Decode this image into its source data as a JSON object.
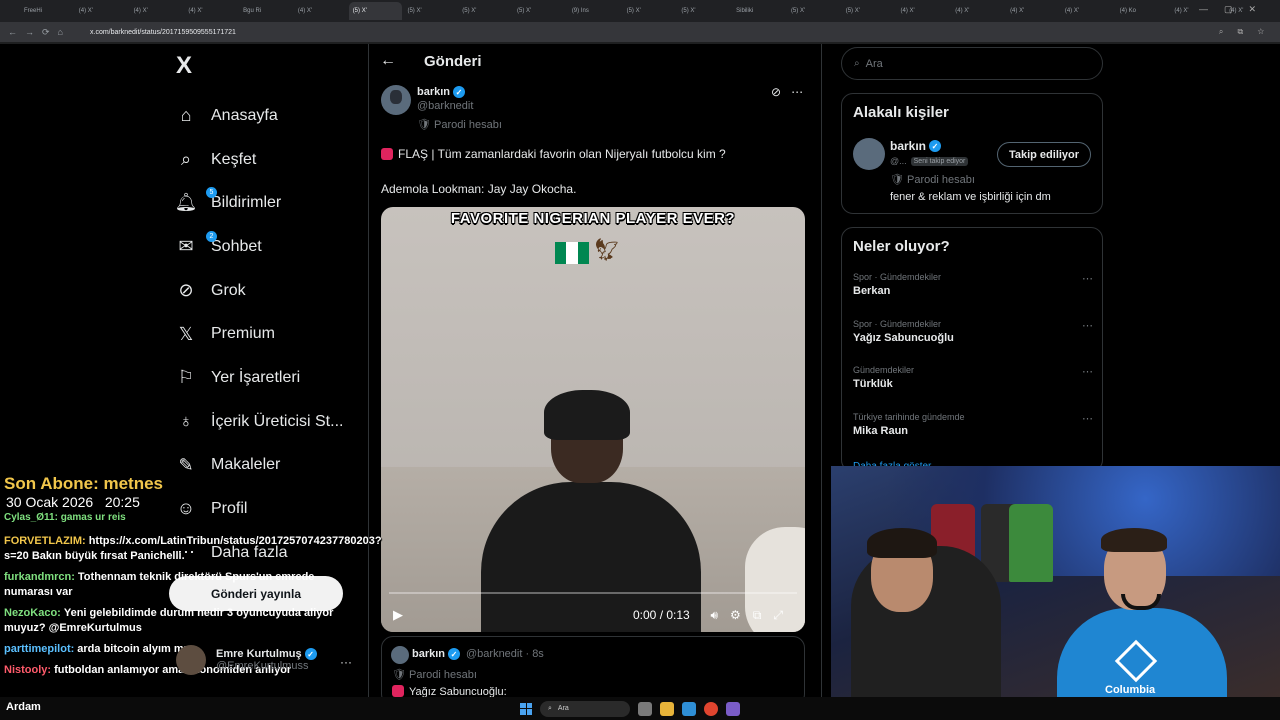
{
  "browser": {
    "tabs": [
      "FreeHi",
      "(4) X'",
      "(4) X'",
      "(4) X'",
      "Bgu Ri",
      "(4) X'",
      "(5) X'",
      "(5) X'",
      "(5) X'",
      "(5) X'",
      "(9) Ins",
      "(5) X'",
      "(5) X'",
      "Sibiliki",
      "(5) X'",
      "(5) X'",
      "(4) X'",
      "(4) X'",
      "(4) X'",
      "(4) X'",
      "(4) Ko",
      "(4) X'",
      "(4) X'"
    ],
    "url": "x.com/barknedit/status/2017159509555171721",
    "address_icons": "⌕ ⧉ ☆",
    "nav_icons": "←→⟳⌂"
  },
  "sidebar": {
    "logo": "X",
    "items": [
      {
        "label": "Anasayfa",
        "icon": "home-icon",
        "glyph": "⌂"
      },
      {
        "label": "Keşfet",
        "icon": "search-icon",
        "glyph": "⌕"
      },
      {
        "label": "Bildirimler",
        "icon": "bell-icon",
        "glyph": "🔔︎",
        "badge": "5"
      },
      {
        "label": "Sohbet",
        "icon": "mail-icon",
        "glyph": "✉",
        "badge": "2"
      },
      {
        "label": "Grok",
        "icon": "grok-icon",
        "glyph": "⊘"
      },
      {
        "label": "Premium",
        "icon": "x-premium-icon",
        "glyph": "𝕏"
      },
      {
        "label": "Yer İşaretleri",
        "icon": "bookmark-icon",
        "glyph": "⚐"
      },
      {
        "label": "İçerik Üreticisi St...",
        "icon": "creator-studio-icon",
        "glyph": "♁"
      },
      {
        "label": "Makaleler",
        "icon": "articles-icon",
        "glyph": "✎"
      },
      {
        "label": "Profil",
        "icon": "profile-icon",
        "glyph": "☺"
      },
      {
        "label": "Daha fazla",
        "icon": "more-icon",
        "glyph": "⋯"
      }
    ],
    "post_button": "Gönderi yayınla",
    "account": {
      "name": "Emre Kurtulmuş",
      "handle": "@EmreKurtulmuss",
      "more": "···"
    }
  },
  "main": {
    "title": "Gönderi",
    "back": "←",
    "post": {
      "author": "barkın",
      "handle": "@barknedit",
      "parody": "Parodi hesabı",
      "text1": "FLAŞ | Tüm zamanlardaki favorin olan Nijeryalı futbolcu kim ?",
      "text2": "Ademola Lookman: Jay Jay Okocha.",
      "video": {
        "overlay_title": "FAVORITE NIGERIAN PLAYER EVER?",
        "time": "0:00 / 0:13",
        "progress": 0.0
      }
    },
    "reply": {
      "author": "barkın",
      "handle": "@barknedit · 8s",
      "parody": "Parodi hesabı",
      "text": "Yağız Sabuncuoğlu:"
    }
  },
  "right": {
    "search_placeholder": "Ara",
    "related": {
      "title": "Alakalı kişiler",
      "name": "barkın",
      "handle": "@...",
      "follows_you": "Seni takip ediyor",
      "follow_button": "Takip ediliyor",
      "parody": "Parodi hesabı",
      "bio": "fener & reklam ve işbirliği için dm"
    },
    "trends": {
      "title": "Neler oluyor?",
      "items": [
        {
          "meta": "Spor · Gündemdekiler",
          "name": "Berkan"
        },
        {
          "meta": "Spor · Gündemdekiler",
          "name": "Yağız Sabuncuoğlu"
        },
        {
          "meta": "Gündemdekiler",
          "name": "Türklük"
        },
        {
          "meta": "Türkiye tarihinde gündemde",
          "name": "Mika Raun"
        }
      ],
      "show_more": "Daha fazla göster"
    }
  },
  "stream": {
    "sub_label": "Son Abone: metnes",
    "date": "30 Ocak 2026",
    "time": "20:25",
    "partial_line": "Cylas_Ø11: gamas ur reis",
    "chat": [
      {
        "user": "FORVETLAZIM:",
        "text": "https://x.com/LatinTribun/status/2017257074237780203?s=20 Bakın büyük fırsat Panichelli.",
        "color": "#f1c64b"
      },
      {
        "user": "furkandmrcn:",
        "text": "Tothennam teknik direktörü Spurs'un emrede numarası var",
        "color": "#7fe07f"
      },
      {
        "user": "NezoKaco:",
        "text": "Yeni gelebildimde durum nedir 3 oyuncuyuda aliyor muyuz? @EmreKurtulmus",
        "color": "#7fe07f"
      },
      {
        "user": "parttimepilot:",
        "text": "arda bitcoin alyım mı",
        "color": "#5bc0ff"
      },
      {
        "user": "Nistooly:",
        "text": "futboldan anlamıyor ama ekonomiden anlıyor",
        "color": "#ff5b6b"
      }
    ],
    "streamer_name": "Ardam",
    "columbia": "Columbia"
  },
  "taskbar": {
    "search": "Ara"
  },
  "colors": {
    "accent": "#1d9bf0",
    "bg": "#000000",
    "border": "#2f3336"
  }
}
